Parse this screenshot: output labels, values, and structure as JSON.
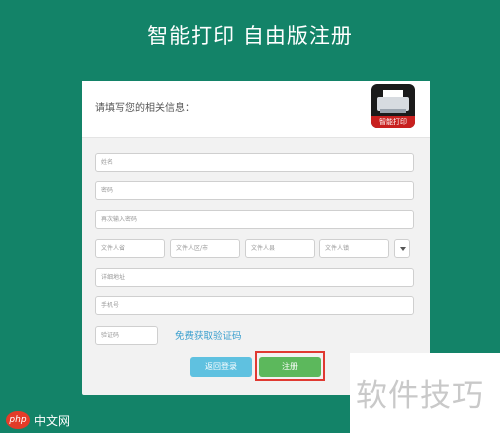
{
  "page": {
    "title": "智能打印  自由版注册"
  },
  "form": {
    "header_text": "请填写您的相关信息：",
    "logo_label": "智能打印",
    "fields": {
      "name": {
        "placeholder": "姓名"
      },
      "password": {
        "placeholder": "密码"
      },
      "password_confirm": {
        "placeholder": "再次输入密码"
      },
      "province": {
        "placeholder": "文件人省"
      },
      "city": {
        "placeholder": "文件人区/市"
      },
      "district": {
        "placeholder": "文件人县"
      },
      "town": {
        "placeholder": "文件人镇"
      },
      "address": {
        "placeholder": "详细地址"
      },
      "phone": {
        "placeholder": "手机号"
      },
      "captcha": {
        "placeholder": "验证码"
      }
    },
    "captcha_link": "免费获取验证码",
    "back_button": "返回登录",
    "register_button": "注册"
  },
  "watermark": {
    "text": "软件技巧",
    "php_logo": "php",
    "site": "中文网"
  },
  "colors": {
    "background": "#138368",
    "back_button": "#5fc1e0",
    "register_button": "#5cb85c",
    "highlight": "#e03a32",
    "link": "#3a9fce"
  }
}
